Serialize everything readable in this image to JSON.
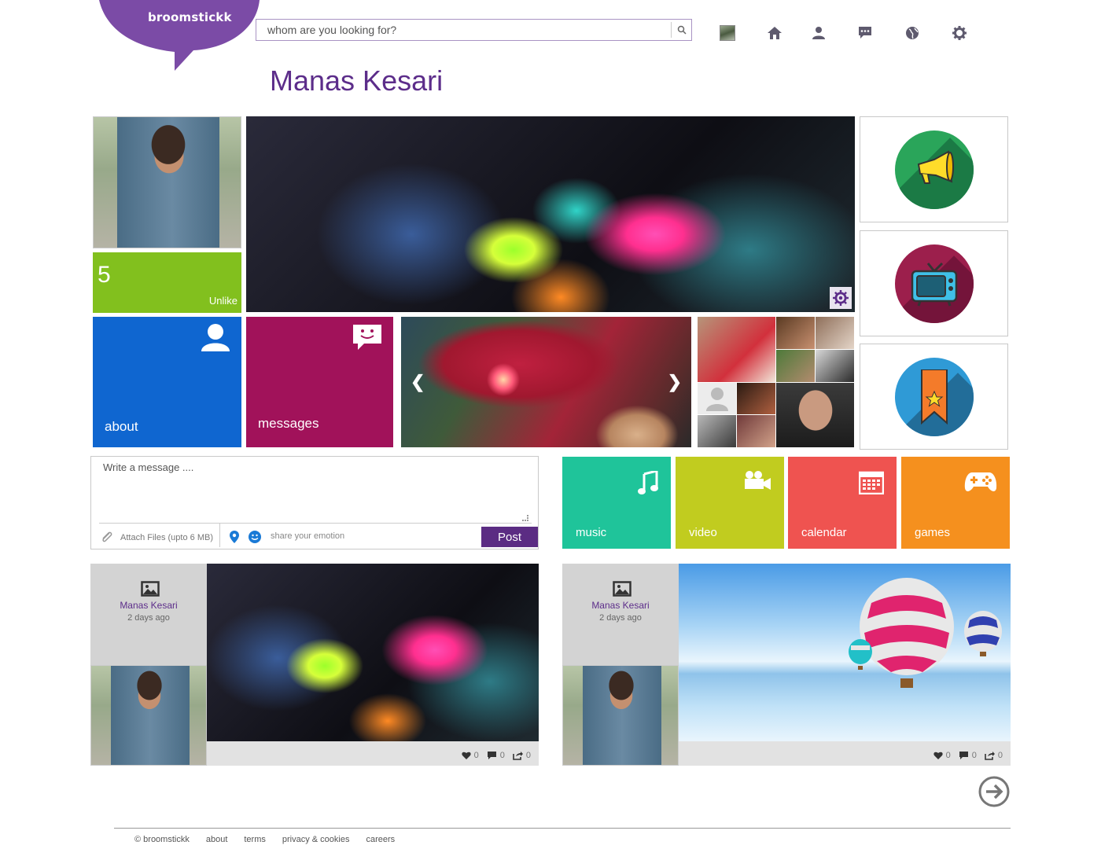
{
  "brand": {
    "name": "broomstickk",
    "color": "#7b4ba6"
  },
  "search": {
    "placeholder": "whom are you looking for?"
  },
  "nav": {
    "icons": [
      "avatar",
      "home-icon",
      "user-icon",
      "chat-icon",
      "globe-icon",
      "gear-icon"
    ]
  },
  "profile": {
    "name": "Manas Kesari",
    "likes": "5",
    "like_action": "Unlike"
  },
  "tiles": {
    "about": "about",
    "messages": "messages"
  },
  "side_apps": [
    "megaphone-icon",
    "tv-icon",
    "bookmark-star-icon"
  ],
  "compose": {
    "placeholder": "Write a message ....",
    "attach_label": "Attach Files (upto 6 MB)",
    "emotion_placeholder": "share your emotion",
    "post_label": "Post"
  },
  "apps": [
    {
      "label": "music",
      "color": "#1fc49a",
      "icon": "music-note-icon"
    },
    {
      "label": "video",
      "color": "#c1cc1f",
      "icon": "video-camera-icon"
    },
    {
      "label": "calendar",
      "color": "#ef5350",
      "icon": "calendar-icon"
    },
    {
      "label": "games",
      "color": "#f5901e",
      "icon": "gamepad-icon"
    }
  ],
  "posts": [
    {
      "author": "Manas Kesari",
      "time": "2 days ago",
      "likes": "0",
      "comments": "0",
      "shares": "0"
    },
    {
      "author": "Manas Kesari",
      "time": "2 days ago",
      "likes": "0",
      "comments": "0",
      "shares": "0"
    }
  ],
  "footer": {
    "links": [
      "© broomstickk",
      "about",
      "terms",
      "privacy & cookies",
      "careers"
    ]
  }
}
